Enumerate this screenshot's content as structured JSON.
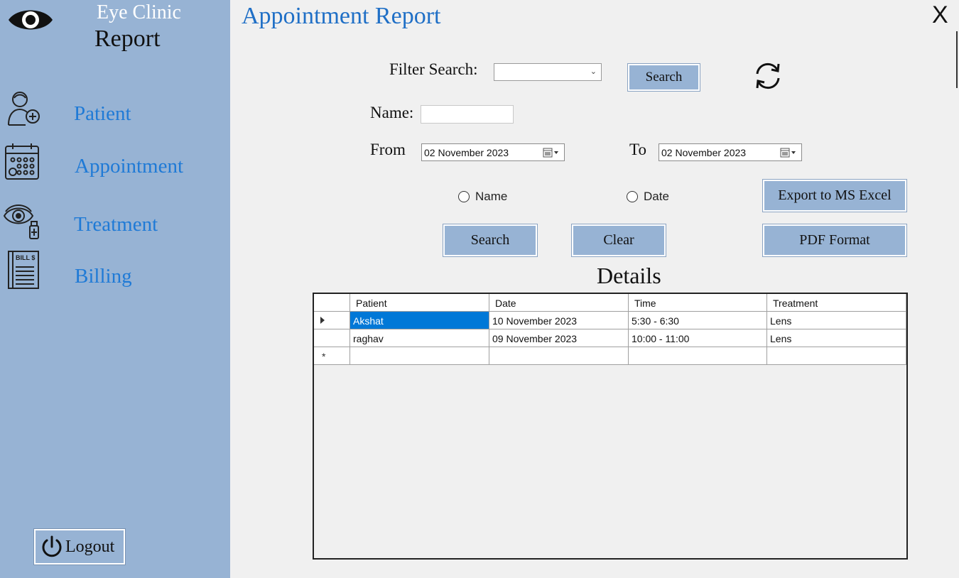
{
  "app": {
    "clinic_name": "Eye Clinic",
    "section_title": "Report",
    "page_title": "Appointment Report",
    "close_label": "X"
  },
  "sidebar": {
    "items": [
      {
        "label": "Patient",
        "icon": "patient-add-icon"
      },
      {
        "label": "Appointment",
        "icon": "calendar-icon"
      },
      {
        "label": "Treatment",
        "icon": "eye-drop-icon"
      },
      {
        "label": "Billing",
        "icon": "bill-icon"
      }
    ],
    "bill_icon_text": "BILL $",
    "logout_label": "Logout"
  },
  "filters": {
    "filter_search_label": "Filter Search:",
    "filter_search_value": "",
    "search_top_label": "Search",
    "name_label": "Name:",
    "name_value": "",
    "from_label": "From",
    "from_value": "02 November 2023",
    "to_label": "To",
    "to_value": "02 November 2023",
    "radio_name_label": "Name",
    "radio_date_label": "Date",
    "export_excel_label": "Export to MS Excel",
    "search_label": "Search",
    "clear_label": "Clear",
    "pdf_label": "PDF Format"
  },
  "details": {
    "title": "Details",
    "columns": [
      "Patient",
      "Date",
      "Time",
      "Treatment"
    ],
    "rows": [
      [
        "Akshat",
        "10 November 2023",
        "5:30 - 6:30",
        "Lens"
      ],
      [
        "raghav",
        "09 November 2023",
        "10:00 - 11:00",
        "Lens"
      ]
    ],
    "new_row_marker": "*"
  },
  "colors": {
    "sidebar_bg": "#97b3d4",
    "accent_blue": "#1f7ad6",
    "selection": "#0078d7",
    "background": "#f0f0f0"
  }
}
